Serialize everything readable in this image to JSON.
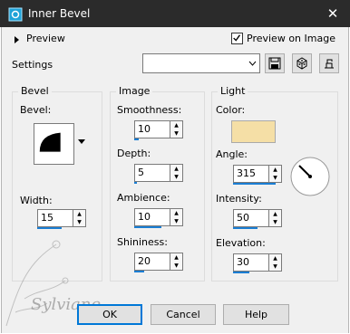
{
  "window": {
    "title": "Inner Bevel",
    "close_glyph": "✕"
  },
  "preview": {
    "toggle_label": "Preview",
    "preview_on_image_label": "Preview on Image",
    "preview_on_image_checked": true
  },
  "settings": {
    "label": "Settings",
    "value": ""
  },
  "bevel_group": {
    "title": "Bevel",
    "bevel_label": "Bevel:",
    "width_label": "Width:",
    "width_value": "15",
    "width_level": 0.5
  },
  "image_group": {
    "title": "Image",
    "smoothness_label": "Smoothness:",
    "smoothness_value": "10",
    "smoothness_level": 0.1,
    "depth_label": "Depth:",
    "depth_value": "5",
    "depth_level": 0.05,
    "ambience_label": "Ambience:",
    "ambience_value": "10",
    "ambience_level": 0.55,
    "shininess_label": "Shininess:",
    "shininess_value": "20",
    "shininess_level": 0.2
  },
  "light_group": {
    "title": "Light",
    "color_label": "Color:",
    "color_value": "#f5dfa6",
    "angle_label": "Angle:",
    "angle_value": "315",
    "angle_level": 0.875,
    "intensity_label": "Intensity:",
    "intensity_value": "50",
    "intensity_level": 0.5,
    "elevation_label": "Elevation:",
    "elevation_value": "30",
    "elevation_level": 0.33
  },
  "buttons": {
    "ok": "OK",
    "cancel": "Cancel",
    "help": "Help"
  },
  "watermark": "Sylviane",
  "colors": {
    "accent": "#1a7ed4",
    "titlebar": "#2b2b2b"
  }
}
